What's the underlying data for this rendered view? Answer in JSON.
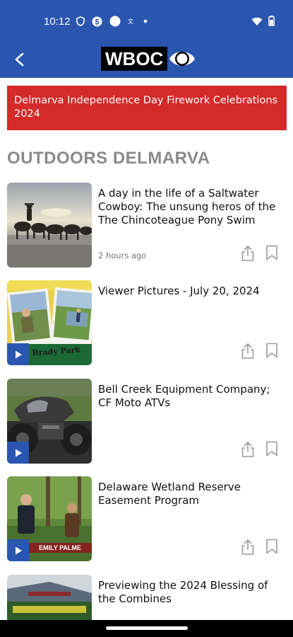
{
  "status_bar": {
    "time": "10:12",
    "left_icons": [
      "shield-icon",
      "dollar-circle-icon",
      "dot-filled-icon",
      "translate-icon",
      "small-dot-icon"
    ],
    "right_icons": [
      "wifi-icon",
      "battery-icon"
    ]
  },
  "app_bar": {
    "back_icon": "back-arrow-icon",
    "logo_text": "WBOC",
    "background": "#2a56b0"
  },
  "banner": {
    "text": "Delmarva Independence Day Firework Celebrations 2024",
    "background": "#d42a2a"
  },
  "section": {
    "title": "OUTDOORS DELMARVA"
  },
  "articles": [
    {
      "headline": "A day in the life of a Saltwater Cowboy: The unsung heros of the The Chincoteague Pony Swim",
      "timestamp": "2 hours ago",
      "video": false
    },
    {
      "headline": "Viewer Pictures - July 20, 2024",
      "timestamp": "",
      "video": true,
      "image_text": "Brady Park"
    },
    {
      "headline": "Bell Creek Equipment Company; CF Moto ATVs",
      "timestamp": "",
      "video": true
    },
    {
      "headline": "Delaware Wetland Reserve Easement Program",
      "timestamp": "",
      "video": true,
      "image_text": "EMILY PALME"
    },
    {
      "headline": "Previewing the 2024 Blessing of the Combines",
      "timestamp": "",
      "video": false
    }
  ],
  "colors": {
    "brand_blue": "#2a56b0",
    "alert_red": "#d42a2a",
    "section_gray": "#8a8a8a"
  }
}
